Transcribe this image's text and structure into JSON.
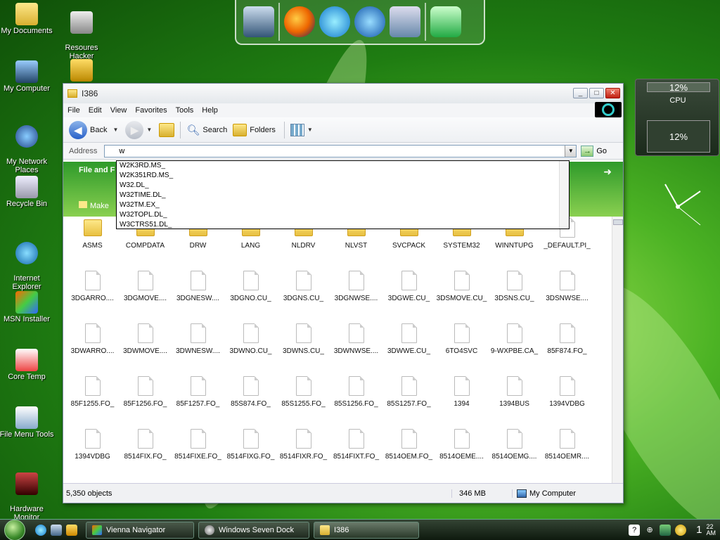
{
  "desktop": {
    "icons": [
      {
        "label": "My Documents"
      },
      {
        "label": "Resoures\nHacker"
      },
      {
        "label": "My Computer"
      },
      {
        "label": "My Network\nPlaces"
      },
      {
        "label": "Recycle Bin"
      },
      {
        "label": "Internet\nExplorer"
      },
      {
        "label": "MSN Installer"
      },
      {
        "label": "Core Temp"
      },
      {
        "label": "File Menu Tools"
      },
      {
        "label": "Hardware\nMonitor"
      }
    ]
  },
  "cpu_gadget": {
    "top_value": "12%",
    "label": "CPU",
    "bottom_value": "12%"
  },
  "window": {
    "title": "I386",
    "menu": [
      "File",
      "Edit",
      "View",
      "Favorites",
      "Tools",
      "Help"
    ],
    "toolbar": {
      "back": "Back",
      "search": "Search",
      "folders": "Folders"
    },
    "address": {
      "label": "Address",
      "value": "w",
      "go": "Go"
    },
    "taskpane": {
      "title": "File and F",
      "make": "Make"
    },
    "autocomplete": [
      "W2K3RD.MS_",
      "W2K351RD.MS_",
      "W32.DL_",
      "W32TIME.DL_",
      "W32TM.EX_",
      "W32TOPL.DL_",
      "W3CTRS51.DL_"
    ],
    "files": [
      {
        "name": "ASMS",
        "type": "folder"
      },
      {
        "name": "COMPDATA",
        "type": "folder"
      },
      {
        "name": "DRW",
        "type": "folder"
      },
      {
        "name": "LANG",
        "type": "folder"
      },
      {
        "name": "NLDRV",
        "type": "folder"
      },
      {
        "name": "NLVST",
        "type": "folder"
      },
      {
        "name": "SVCPACK",
        "type": "folder"
      },
      {
        "name": "SYSTEM32",
        "type": "folder"
      },
      {
        "name": "WINNTUPG",
        "type": "folder"
      },
      {
        "name": "_DEFAULT.PI_",
        "type": "file"
      },
      {
        "name": "3DGARRO....",
        "type": "file"
      },
      {
        "name": "3DGMOVE....",
        "type": "file"
      },
      {
        "name": "3DGNESW....",
        "type": "file"
      },
      {
        "name": "3DGNO.CU_",
        "type": "file"
      },
      {
        "name": "3DGNS.CU_",
        "type": "file"
      },
      {
        "name": "3DGNWSE....",
        "type": "file"
      },
      {
        "name": "3DGWE.CU_",
        "type": "file"
      },
      {
        "name": "3DSMOVE.CU_",
        "type": "file"
      },
      {
        "name": "3DSNS.CU_",
        "type": "file"
      },
      {
        "name": "3DSNWSE....",
        "type": "file"
      },
      {
        "name": "3DWARRO....",
        "type": "file"
      },
      {
        "name": "3DWMOVE....",
        "type": "file"
      },
      {
        "name": "3DWNESW....",
        "type": "file"
      },
      {
        "name": "3DWNO.CU_",
        "type": "file"
      },
      {
        "name": "3DWNS.CU_",
        "type": "file"
      },
      {
        "name": "3DWNWSE....",
        "type": "file"
      },
      {
        "name": "3DWWE.CU_",
        "type": "file"
      },
      {
        "name": "6TO4SVC",
        "type": "file"
      },
      {
        "name": "9-WXPBE.CA_",
        "type": "file"
      },
      {
        "name": "85F874.FO_",
        "type": "file"
      },
      {
        "name": "85F1255.FO_",
        "type": "file"
      },
      {
        "name": "85F1256.FO_",
        "type": "file"
      },
      {
        "name": "85F1257.FO_",
        "type": "file"
      },
      {
        "name": "85S874.FO_",
        "type": "file"
      },
      {
        "name": "85S1255.FO_",
        "type": "file"
      },
      {
        "name": "85S1256.FO_",
        "type": "file"
      },
      {
        "name": "85S1257.FO_",
        "type": "file"
      },
      {
        "name": "1394",
        "type": "file"
      },
      {
        "name": "1394BUS",
        "type": "file"
      },
      {
        "name": "1394VDBG",
        "type": "file"
      },
      {
        "name": "1394VDBG",
        "type": "file"
      },
      {
        "name": "8514FIX.FO_",
        "type": "file"
      },
      {
        "name": "8514FIXE.FO_",
        "type": "file"
      },
      {
        "name": "8514FIXG.FO_",
        "type": "file"
      },
      {
        "name": "8514FIXR.FO_",
        "type": "file"
      },
      {
        "name": "8514FIXT.FO_",
        "type": "file"
      },
      {
        "name": "8514OEM.FO_",
        "type": "file"
      },
      {
        "name": "8514OEME....",
        "type": "file"
      },
      {
        "name": "8514OEMG....",
        "type": "file"
      },
      {
        "name": "8514OEMR....",
        "type": "file"
      }
    ],
    "status": {
      "objects": "5,350 objects",
      "size": "346 MB",
      "location": "My Computer"
    }
  },
  "taskbar": {
    "buttons": [
      {
        "label": "Vienna Navigator"
      },
      {
        "label": "Windows Seven Dock"
      },
      {
        "label": "I386"
      }
    ],
    "clock": {
      "time": "1",
      "minutes": "22",
      "ampm": "AM"
    }
  },
  "colors": {
    "window_title": "#222222",
    "taskpane": "#2e9a2a",
    "taskbar": "#1a2a1a"
  }
}
